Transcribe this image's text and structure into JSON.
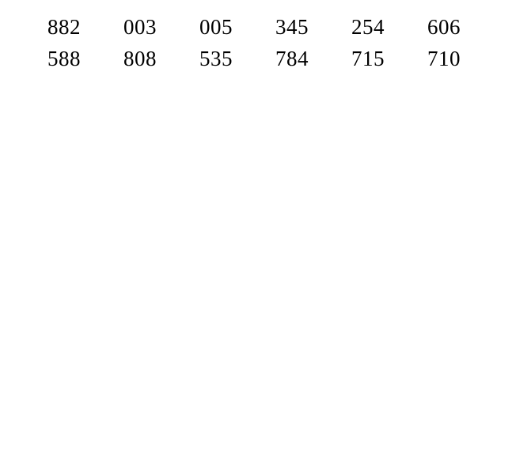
{
  "grid": {
    "rows": [
      [
        "882",
        "003",
        "005",
        "345",
        "254",
        "606"
      ],
      [
        "588",
        "808",
        "535",
        "784",
        "715",
        "710"
      ]
    ]
  }
}
